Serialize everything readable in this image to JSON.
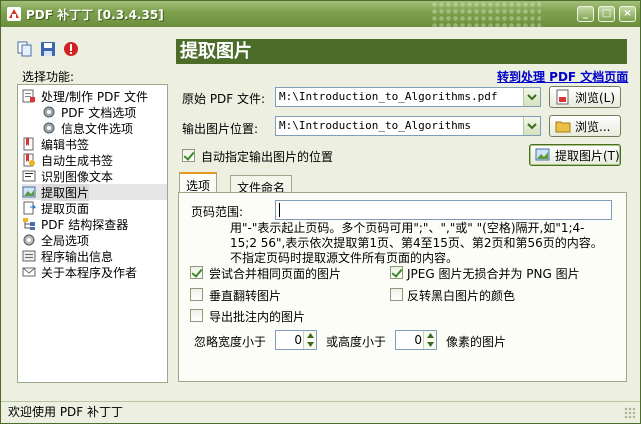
{
  "window": {
    "title": "PDF 补丁丁 [0.3.4.35]",
    "min": "_",
    "max": "□",
    "close": "×"
  },
  "sidebar": {
    "choose_label": "选择功能:",
    "items": [
      {
        "label": "处理/制作 PDF 文件",
        "icon": "pdf-edit-icon"
      },
      {
        "label": "PDF 文档选项",
        "icon": "gear-icon"
      },
      {
        "label": "信息文件选项",
        "icon": "gear-icon"
      },
      {
        "label": "编辑书签",
        "icon": "bookmark-icon"
      },
      {
        "label": "自动生成书签",
        "icon": "bookmark-auto-icon"
      },
      {
        "label": "识别图像文本",
        "icon": "ocr-icon"
      },
      {
        "label": "提取图片",
        "icon": "image-extract-icon"
      },
      {
        "label": "提取页面",
        "icon": "page-extract-icon"
      },
      {
        "label": "PDF 结构探查器",
        "icon": "structure-icon"
      },
      {
        "label": "全局选项",
        "icon": "settings-icon"
      },
      {
        "label": "程序输出信息",
        "icon": "output-icon"
      },
      {
        "label": "关于本程序及作者",
        "icon": "mail-icon"
      }
    ]
  },
  "main": {
    "title": "提取图片",
    "link": "转到处理 PDF 文档页面",
    "source_label": "原始 PDF 文件:",
    "source_value": "M:\\Introduction_to_Algorithms.pdf",
    "browse_label": "浏览(L)",
    "output_label": "输出图片位置:",
    "output_value": "M:\\Introduction_to_Algorithms",
    "browse2_label": "浏览...",
    "auto_output_label": "自动指定输出图片的位置",
    "extract_button": "提取图片(T)",
    "tabs": [
      {
        "label": "选项"
      },
      {
        "label": "文件命名"
      }
    ],
    "page_range_label": "页码范围:",
    "help_text": "用\"-\"表示起止页码。多个页码可用\";\"、\",\"或\" \"(空格)隔开,如\"1;4-15;2 56\",表示依次提取第1页、第4至15页、第2页和第56页的内容。不指定页码时提取源文件所有页面的内容。",
    "options": [
      {
        "label": "尝试合并相同页面的图片",
        "checked": true
      },
      {
        "label": "JPEG 图片无损合并为 PNG 图片",
        "checked": true
      },
      {
        "label": "垂直翻转图片",
        "checked": false
      },
      {
        "label": "反转黑白图片的颜色",
        "checked": false
      },
      {
        "label": "导出批注内的图片",
        "checked": false
      }
    ],
    "ignore_width_label": "忽略宽度小于",
    "width_value": "0",
    "or_height_label": "或高度小于",
    "height_value": "0",
    "pixel_label": "像素的图片"
  },
  "status": {
    "text": "欢迎使用 PDF 补丁丁"
  }
}
